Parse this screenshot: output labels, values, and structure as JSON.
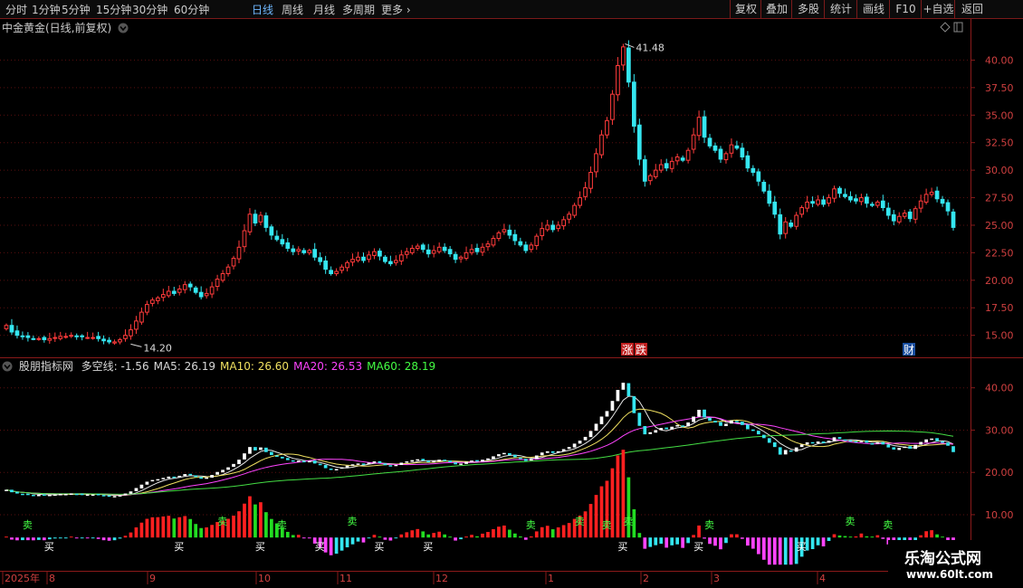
{
  "toolbar": {
    "timeframes": [
      {
        "label": "分时",
        "active": false
      },
      {
        "label": "1分钟",
        "active": false
      },
      {
        "label": "5分钟",
        "active": false
      },
      {
        "label": "15分钟",
        "active": false
      },
      {
        "label": "30分钟",
        "active": false
      },
      {
        "label": "60分钟",
        "active": false
      },
      {
        "label": "日线",
        "active": true
      },
      {
        "label": "周线",
        "active": false
      },
      {
        "label": "月线",
        "active": false
      },
      {
        "label": "多周期",
        "active": false
      },
      {
        "label": "更多",
        "active": false
      }
    ],
    "buttons": [
      "复权",
      "叠加",
      "多股",
      "统计",
      "画线",
      "F10",
      "+自选",
      "返回"
    ]
  },
  "main_chart": {
    "title": "中金黄金(日线,前复权)",
    "y_ticks": [
      "40.00",
      "37.50",
      "35.00",
      "32.50",
      "30.00",
      "27.50",
      "25.00",
      "22.50",
      "20.00",
      "17.50",
      "15.00"
    ],
    "high_label": "41.48",
    "low_label": "14.20",
    "event_labels": [
      "涨",
      "跌",
      "财"
    ]
  },
  "indicator": {
    "name": "股朋指标网",
    "items": [
      {
        "label": "多空线: -1.56",
        "color": "#d8d8d8"
      },
      {
        "label": "MA5: 26.19",
        "color": "#d8d8d8"
      },
      {
        "label": "MA10: 26.60",
        "color": "#f0e060"
      },
      {
        "label": "MA20: 26.53",
        "color": "#ff44ff"
      },
      {
        "label": "MA60: 28.19",
        "color": "#44ff44"
      }
    ],
    "y_ticks": [
      "40.00",
      "30.00",
      "20.00",
      "10.00"
    ],
    "signal_buy": "买",
    "signal_sell": "卖"
  },
  "x_axis": {
    "labels": [
      "2025年",
      "8",
      "9",
      "10",
      "11",
      "12",
      "1",
      "2",
      "3",
      "4"
    ]
  },
  "watermark": {
    "title": "乐淘公式网",
    "url": "www.60lt.com"
  },
  "chart_data": {
    "type": "candlestick",
    "title": "中金黄金(日线,前复权)",
    "ylim": [
      13.0,
      42.5
    ],
    "high": 41.48,
    "low": 14.2,
    "x_labels": [
      "2025年",
      "8",
      "9",
      "10",
      "11",
      "12",
      "1",
      "2",
      "3",
      "4"
    ],
    "close": [
      15.9,
      15.3,
      15.0,
      14.9,
      14.8,
      14.7,
      14.7,
      14.6,
      14.7,
      14.8,
      14.9,
      14.9,
      15.0,
      14.9,
      14.9,
      14.8,
      14.8,
      14.7,
      14.5,
      14.4,
      14.4,
      14.6,
      15.0,
      15.5,
      16.3,
      17.1,
      17.8,
      18.2,
      18.4,
      18.7,
      19.0,
      18.8,
      19.2,
      19.6,
      19.4,
      18.9,
      18.5,
      18.8,
      19.4,
      20.1,
      20.6,
      21.2,
      22.0,
      23.0,
      24.5,
      26.0,
      25.2,
      25.9,
      24.8,
      24.1,
      23.7,
      23.3,
      22.9,
      22.6,
      22.8,
      22.5,
      22.7,
      22.1,
      21.7,
      21.0,
      20.6,
      20.8,
      21.2,
      21.6,
      21.9,
      22.1,
      21.8,
      22.3,
      22.6,
      22.2,
      21.7,
      21.5,
      21.8,
      22.3,
      22.6,
      22.9,
      23.1,
      22.8,
      22.4,
      22.7,
      23.0,
      22.7,
      22.4,
      21.9,
      22.1,
      22.5,
      22.8,
      22.6,
      23.0,
      23.3,
      23.8,
      24.3,
      24.6,
      24.1,
      23.6,
      23.2,
      22.7,
      23.2,
      24.0,
      24.7,
      25.0,
      24.6,
      25.0,
      25.5,
      26.0,
      26.8,
      27.5,
      28.4,
      29.8,
      31.5,
      33.2,
      34.5,
      36.9,
      39.5,
      41.2,
      38.0,
      34.0,
      31.0,
      29.0,
      29.5,
      30.0,
      30.5,
      30.2,
      30.8,
      31.2,
      30.9,
      31.8,
      33.2,
      34.8,
      33.0,
      32.2,
      31.8,
      31.0,
      31.5,
      32.3,
      32.0,
      31.2,
      30.2,
      29.8,
      29.0,
      28.1,
      27.0,
      26.0,
      24.2,
      25.3,
      24.9,
      25.9,
      26.6,
      27.1,
      27.0,
      27.3,
      26.9,
      27.5,
      28.3,
      27.9,
      27.6,
      27.3,
      27.2,
      27.5,
      27.0,
      26.8,
      27.1,
      26.6,
      25.9,
      25.4,
      25.8,
      26.1,
      25.6,
      26.5,
      27.2,
      27.8,
      28.0,
      27.4,
      27.0,
      26.3,
      24.8
    ]
  }
}
